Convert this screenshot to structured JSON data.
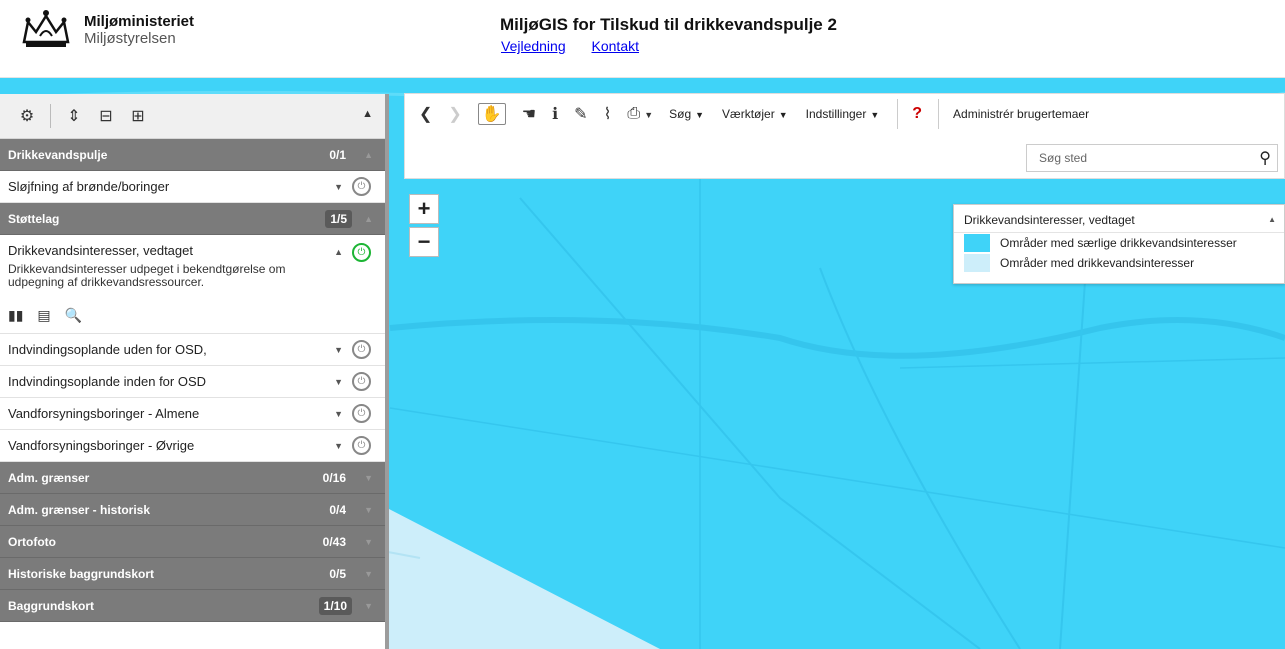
{
  "header": {
    "org_name": "Miljøministeriet",
    "org_sub": "Miljøstyrelsen",
    "title": "MiljøGIS for Tilskud til drikkevandspulje 2",
    "links": [
      "Vejledning",
      "Kontakt"
    ]
  },
  "sidebar": {
    "groups": [
      {
        "label": "Drikkevandspulje",
        "count": "0/1"
      },
      {
        "label": "Støttelag",
        "count": "1/5"
      },
      {
        "label": "Adm. grænser",
        "count": "0/16"
      },
      {
        "label": "Adm. grænser - historisk",
        "count": "0/4"
      },
      {
        "label": "Ortofoto",
        "count": "0/43"
      },
      {
        "label": "Historiske baggrundskort",
        "count": "0/5"
      },
      {
        "label": "Baggrundskort",
        "count": "1/10"
      }
    ],
    "layers": [
      {
        "label": "Sløjfning af brønde/boringer"
      },
      {
        "label": "Drikkevandsinteresser, vedtaget",
        "description": "Drikkevandsinteresser udpeget i bekendtgørelse om udpegning af drikkevandsressourcer."
      },
      {
        "label": "Indvindingsoplande uden for OSD,"
      },
      {
        "label": "Indvindingsoplande inden for OSD"
      },
      {
        "label": "Vandforsyningsboringer - Almene"
      },
      {
        "label": "Vandforsyningsboringer - Øvrige"
      }
    ]
  },
  "toolbar": {
    "menus": [
      "Søg",
      "Værktøjer",
      "Indstillinger"
    ],
    "admin_label": "Administrér brugertemaer",
    "search_placeholder": "Søg sted",
    "help_symbol": "?"
  },
  "zoom": {
    "in": "+",
    "out": "−"
  },
  "legend": {
    "title": "Drikkevandsinteresser, vedtaget",
    "items": [
      {
        "label": "Områder med særlige drikkevandsinteresser",
        "color": "#3fd3f8"
      },
      {
        "label": "Områder med drikkevandsinteresser",
        "color": "#cdeefa"
      }
    ]
  },
  "colors": {
    "map_primary": "#3fd3f8",
    "map_light": "#cdeefa",
    "group_bg": "#7b7b7b",
    "power_on": "#1db535"
  }
}
